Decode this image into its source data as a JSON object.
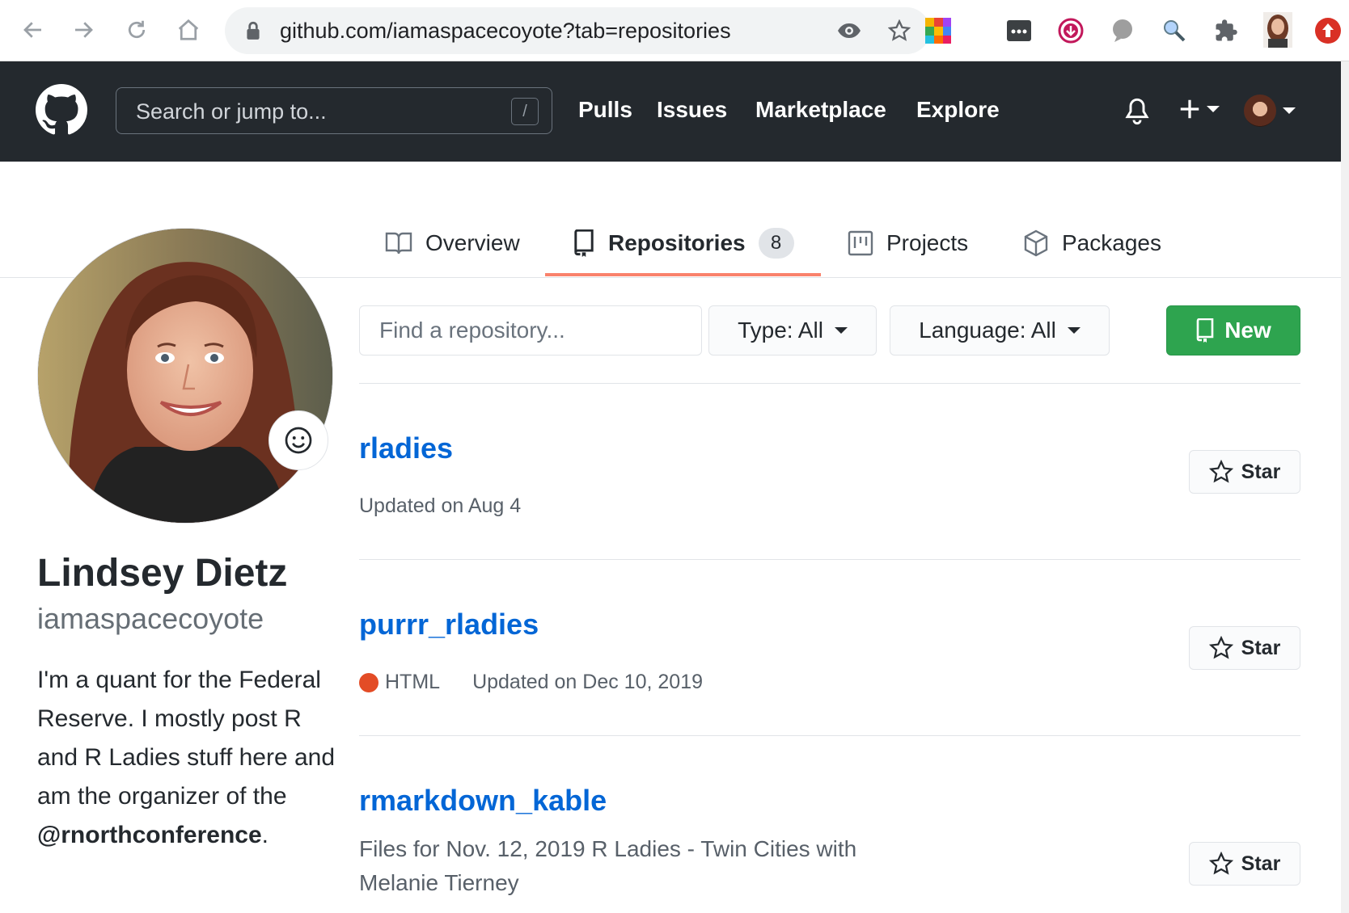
{
  "browser": {
    "url": "github.com/iamaspacecoyote?tab=repositories"
  },
  "header": {
    "search_placeholder": "Search or jump to...",
    "slash_key": "/",
    "nav": [
      "Pulls",
      "Issues",
      "Marketplace",
      "Explore"
    ]
  },
  "tabs": [
    {
      "label": "Overview"
    },
    {
      "label": "Repositories",
      "count": "8"
    },
    {
      "label": "Projects"
    },
    {
      "label": "Packages"
    }
  ],
  "profile": {
    "full_name": "Lindsey Dietz",
    "username": "iamaspacecoyote",
    "bio_text": "I'm a quant for the Federal Reserve. I mostly post R and R Ladies stuff here and am the organizer of the",
    "bio_mention": "@rnorthconference",
    "bio_end": "."
  },
  "filters": {
    "find_placeholder": "Find a repository...",
    "type_label": "Type: All",
    "language_label": "Language: All",
    "new_label": "New"
  },
  "repos": [
    {
      "name": "rladies",
      "updated": "Updated on Aug 4",
      "star_label": "Star"
    },
    {
      "name": "purrr_rladies",
      "language": "HTML",
      "language_color": "#e34c26",
      "updated": "Updated on Dec 10, 2019",
      "star_label": "Star"
    },
    {
      "name": "rmarkdown_kable",
      "description": "Files for Nov. 12, 2019 R Ladies - Twin Cities with Melanie Tierney",
      "star_label": "Star"
    }
  ],
  "colors": {
    "header_bg": "#24292e",
    "link_blue": "#0366d6",
    "new_green": "#2ea44f",
    "tab_underline": "#f9826c"
  }
}
